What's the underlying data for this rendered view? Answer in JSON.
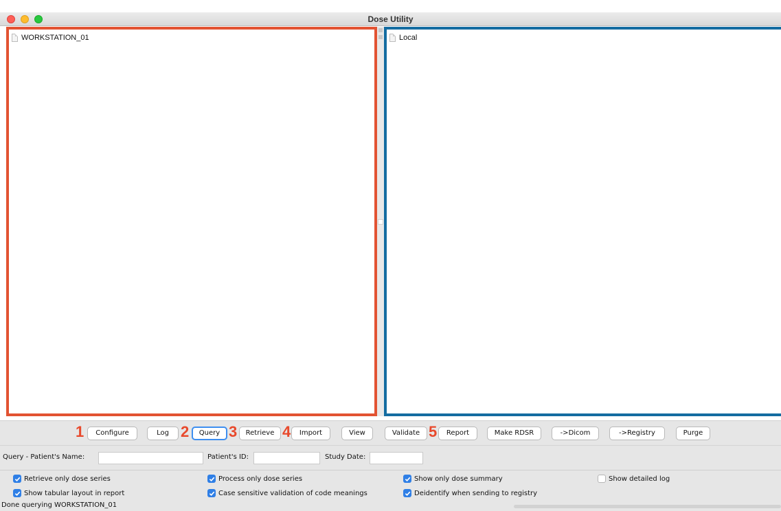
{
  "window": {
    "title": "Dose Utility"
  },
  "panes": {
    "left": {
      "items": [
        "WORKSTATION_01"
      ],
      "highlight_color": "#e25332"
    },
    "right": {
      "items": [
        "Local"
      ],
      "highlight_color": "#146ca1"
    }
  },
  "toolbar": {
    "step_numbers": [
      "1",
      "2",
      "3",
      "4",
      "5"
    ],
    "step_number_color": "#e8492c",
    "buttons": [
      "Configure",
      "Log",
      "Query",
      "Retrieve",
      "Import",
      "View",
      "Validate",
      "Report",
      "Make RDSR",
      "->Dicom",
      "->Registry",
      "Purge"
    ],
    "focused_button": "Query"
  },
  "query": {
    "patient_name_label": "Query - Patient's Name:",
    "patient_name_value": "",
    "patient_id_label": "Patient's ID:",
    "patient_id_value": "",
    "study_date_label": "Study Date:",
    "study_date_value": ""
  },
  "options": [
    {
      "label": "Retrieve only dose series",
      "checked": true
    },
    {
      "label": "Process only dose series",
      "checked": true
    },
    {
      "label": "Show only dose summary",
      "checked": true
    },
    {
      "label": "Show detailed log",
      "checked": false
    },
    {
      "label": "Show tabular layout in report",
      "checked": true
    },
    {
      "label": "Case sensitive validation of code meanings",
      "checked": true
    },
    {
      "label": "Deidentify when sending to registry",
      "checked": true
    }
  ],
  "status": {
    "text": "Done querying  WORKSTATION_01"
  },
  "icons": {
    "tree_item": "document-icon",
    "checkbox": "checkmark-icon"
  },
  "colors": {
    "accent": "#2f7fe6"
  }
}
